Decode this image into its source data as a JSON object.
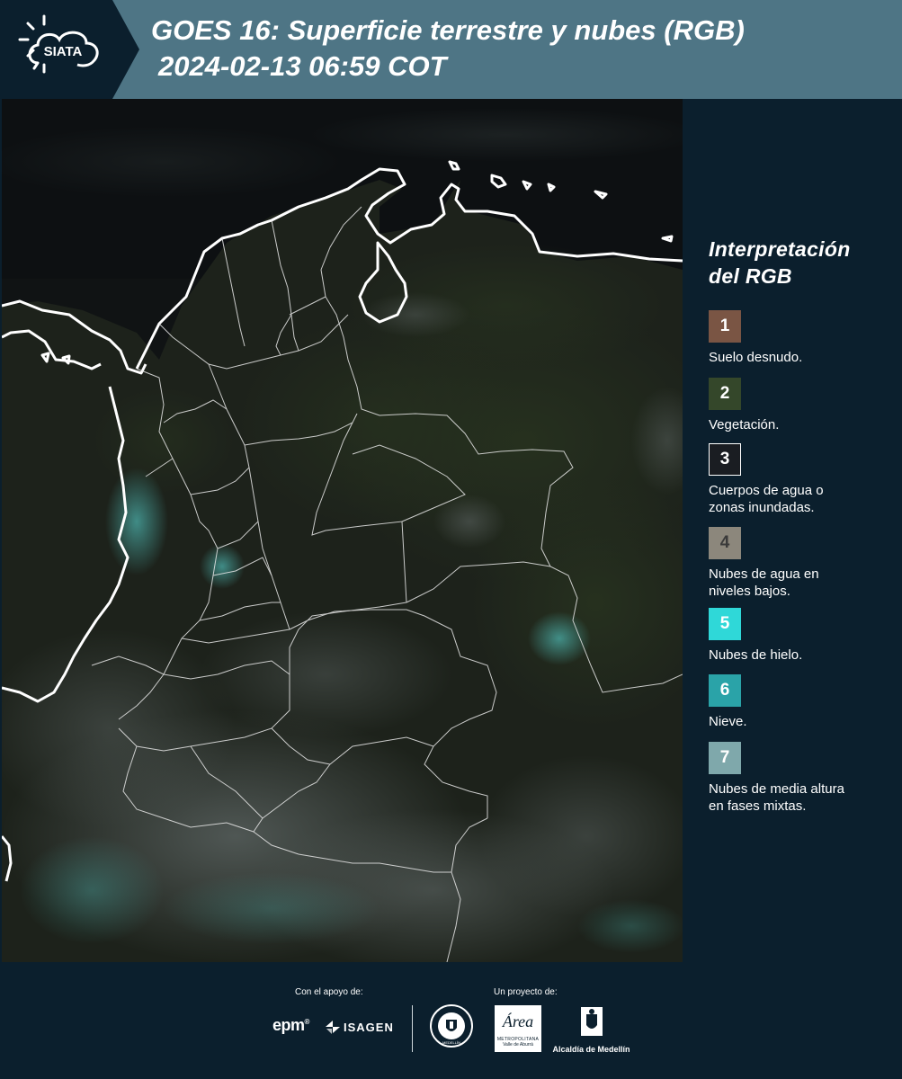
{
  "header": {
    "logo_text": "SIATA",
    "title_line1": "GOES 16: Superficie terrestre y nubes (RGB)",
    "title_line2": "2024-02-13 06:59 COT",
    "background_color": "#4e7585"
  },
  "legend": {
    "title_line1": "Interpretación",
    "title_line2": "del RGB",
    "items": [
      {
        "number": "1",
        "color": "#7a5544",
        "label_line1": "Suelo desnudo.",
        "label_line2": ""
      },
      {
        "number": "2",
        "color": "#34472a",
        "label_line1": "Vegetación.",
        "label_line2": ""
      },
      {
        "number": "3",
        "color": "#1a1d22",
        "label_line1": "Cuerpos de agua o",
        "label_line2": "zonas inundadas."
      },
      {
        "number": "4",
        "color": "#8c877c",
        "label_line1": "Nubes de agua en",
        "label_line2": "niveles bajos."
      },
      {
        "number": "5",
        "color": "#2fd8d8",
        "label_line1": "Nubes de hielo.",
        "label_line2": ""
      },
      {
        "number": "6",
        "color": "#2aa3a8",
        "label_line1": "Nieve.",
        "label_line2": ""
      },
      {
        "number": "7",
        "color": "#7fa8ab",
        "label_line1": "Nubes de media altura",
        "label_line2": "en fases mixtas."
      }
    ]
  },
  "footer": {
    "support_label": "Con el apoyo de:",
    "project_label": "Un proyecto de:",
    "sponsor_epm": "epm",
    "sponsor_isagen": "ISAGEN",
    "partner_area_name": "Área",
    "partner_area_line1": "METROPOLITANA",
    "partner_area_line2": "Valle de Aburrá",
    "partner_alcaldia": "Alcaldía de Medellín",
    "seal_text": "MEDELLÍN"
  }
}
